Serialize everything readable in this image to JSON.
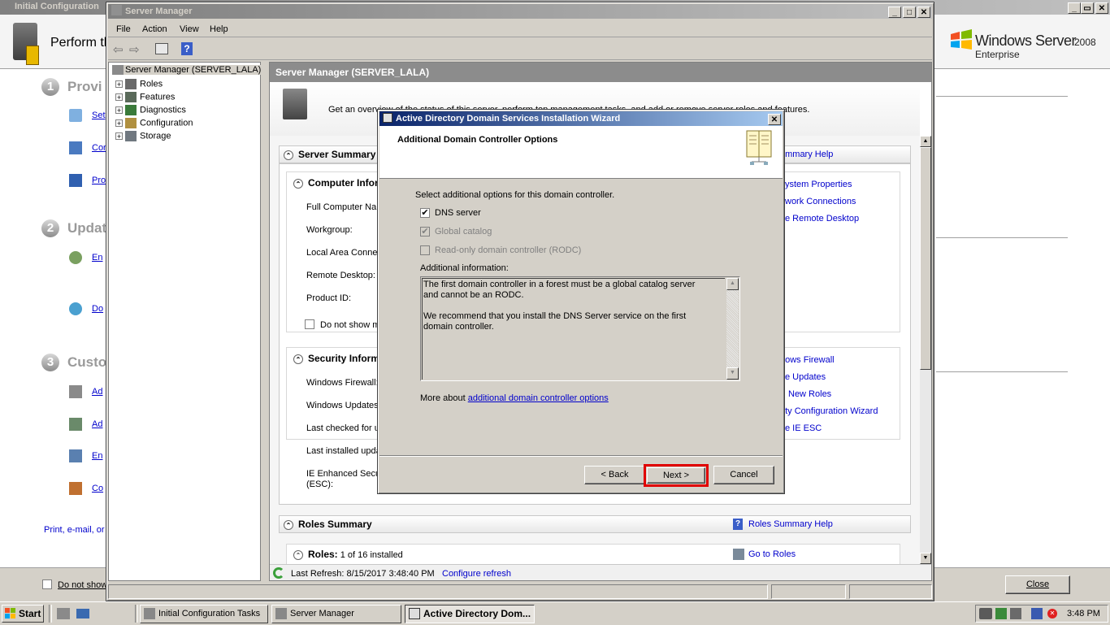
{
  "ict_window": {
    "title": "Initial Configuration",
    "header_text": "Perform th",
    "logo_text": "Windows Server",
    "logo_version": "2008",
    "logo_edition": "Enterprise",
    "sections": [
      {
        "number": "1",
        "title": "Provi"
      },
      {
        "number": "2",
        "title": "Updat"
      },
      {
        "number": "3",
        "title": "Custo"
      }
    ],
    "tasks": [
      "Set",
      "Cor",
      "Pro",
      "En",
      "Do",
      "Ad",
      "Ad",
      "En",
      "Co"
    ],
    "print_link": "Print, e-mail, or s",
    "do_not_show": "Do not show",
    "close_button": "Close"
  },
  "server_manager": {
    "title": "Server Manager",
    "menu": [
      "File",
      "Action",
      "View",
      "Help"
    ],
    "tree": {
      "root": "Server Manager (SERVER_LALA)",
      "items": [
        "Roles",
        "Features",
        "Diagnostics",
        "Configuration",
        "Storage"
      ]
    },
    "content_header": "Server Manager (SERVER_LALA)",
    "overview": "Get an overview of the status of this server, perform top management tasks, and add or remove server roles and features.",
    "server_summary": {
      "title": "Server Summary",
      "help_link": "ummary Help",
      "computer_info_title": "Computer Infor",
      "fields": [
        "Full Computer Nam",
        "Workgroup:",
        "Local Area Conne",
        "Remote Desktop:",
        "Product ID:"
      ],
      "do_not_show": "Do not show m",
      "computer_links": [
        "ystem Properties",
        "work Connections",
        "e Remote Desktop"
      ],
      "security_title": "Security Inform",
      "security_fields": [
        "Windows Firewall:",
        "Windows Updates",
        "Last checked for u",
        "Last installed upda",
        "IE Enhanced Secu",
        "(ESC):"
      ],
      "security_links": [
        "dows Firewall",
        "e Updates",
        "New Roles",
        "rity Configuration Wizard",
        "e IE ESC"
      ]
    },
    "roles_summary": {
      "title": "Roles Summary",
      "help_link": "Roles Summary Help",
      "roles_label": "Roles:",
      "roles_value": "1 of 16 installed",
      "go_link": "Go to Roles"
    },
    "status_bar": {
      "last_refresh": "Last Refresh: 8/15/2017 3:48:40 PM",
      "configure": "Configure refresh"
    }
  },
  "wizard": {
    "title": "Active Directory Domain Services Installation Wizard",
    "page_title": "Additional Domain Controller Options",
    "instruction": "Select additional options for this domain controller.",
    "options": [
      {
        "label": "DNS server",
        "checked": true,
        "enabled": true
      },
      {
        "label": "Global catalog",
        "checked": true,
        "enabled": false
      },
      {
        "label": "Read-only domain controller (RODC)",
        "checked": false,
        "enabled": false
      }
    ],
    "additional_info_label": "Additional information:",
    "info_line1": "The first domain controller in a forest must be a global catalog server and cannot be an RODC.",
    "info_line2": "We recommend that you install the DNS Server service on the first domain controller.",
    "more_about_prefix": "More about",
    "more_about_link": "additional domain controller options",
    "buttons": {
      "back": "< Back",
      "next": "Next >",
      "cancel": "Cancel"
    },
    "highlight_color": "#e00000"
  },
  "taskbar": {
    "start": "Start",
    "tasks": [
      "Initial Configuration Tasks",
      "Server Manager",
      "Active Directory Dom..."
    ],
    "clock": "3:48 PM",
    "tray_icons": [
      "vm-icon",
      "network-icon",
      "volume-icon",
      "network-error-icon"
    ]
  }
}
